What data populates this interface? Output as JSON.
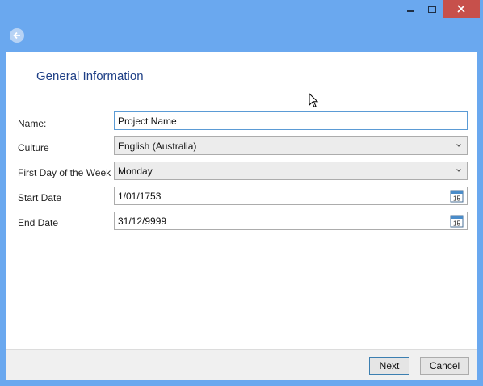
{
  "window": {
    "controls": [
      "minimize-icon",
      "maximize-icon",
      "close-icon"
    ],
    "back_icon": "back-arrow-icon"
  },
  "page": {
    "title": "General Information"
  },
  "form": {
    "name": {
      "label": "Name:",
      "value": "Project Name"
    },
    "culture": {
      "label": "Culture",
      "value": "English (Australia)"
    },
    "first_day": {
      "label": "First Day of the Week",
      "value": "Monday"
    },
    "start_date": {
      "label": "Start Date",
      "value": "1/01/1753",
      "calendar_day": "15"
    },
    "end_date": {
      "label": "End Date",
      "value": "31/12/9999",
      "calendar_day": "15"
    }
  },
  "footer": {
    "next_label": "Next",
    "cancel_label": "Cancel"
  },
  "colors": {
    "window_frame": "#6aa8ef",
    "close_button": "#c7504b",
    "heading": "#1e3f86",
    "focus_border": "#5b9bd5"
  }
}
